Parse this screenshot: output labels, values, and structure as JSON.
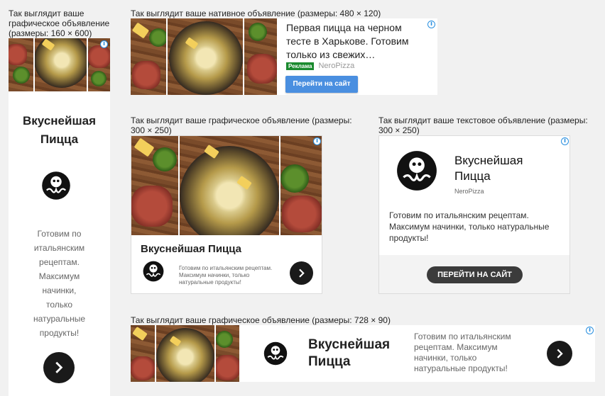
{
  "captions": {
    "vertical": "Так выглядит ваше графическое объявление (размеры: 160 × 600)",
    "native": "Так выглядит ваше нативное объявление (размеры: 480 × 120)",
    "graphic300": "Так выглядит ваше графическое объявление (размеры: 300 × 250)",
    "text300": "Так выглядит ваше текстовое объявление (размеры: 300 × 250)",
    "graphic728": "Так выглядит ваше графическое объявление (размеры: 728 × 90)"
  },
  "ad": {
    "title": "Вкуснейшая Пицца",
    "description": "Готовим по итальянским рецептам. Максимум начинки, только натуральные продукты!",
    "brand": "NeroPizza",
    "info_icon": "i"
  },
  "native": {
    "headline": "Первая пицца на черном тесте в Харькове. Готовим только из свежих…",
    "badge": "Реклама",
    "brand": "NeroPizza",
    "cta": "Перейти на сайт"
  },
  "text_ad": {
    "cta": "ПЕРЕЙТИ НА САЙТ"
  },
  "colors": {
    "accent": "#4a8fe0",
    "badge": "#1a8a2e",
    "dark_button": "#1a1a1a",
    "cta_dark": "#3b3b3b"
  },
  "icons": [
    "info-icon",
    "octopus-logo-icon",
    "chevron-right-icon"
  ]
}
